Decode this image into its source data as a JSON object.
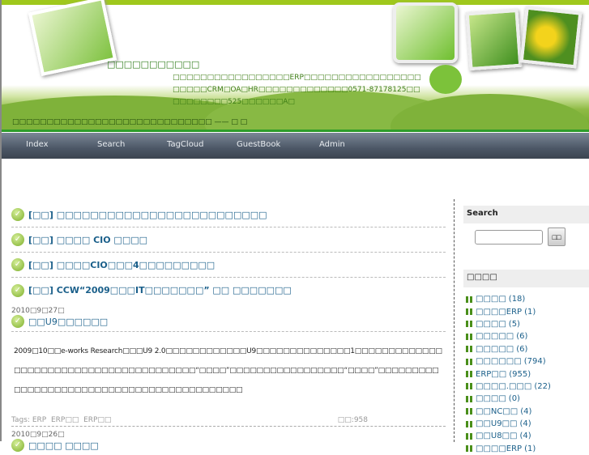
{
  "header": {
    "site_title": "□□□□□□□□□□□",
    "description": "□□□□□□□□□□□□□□□□□ERP□□□□□□□□□□□□□□□□□□□□□□CRM□OA□HR□□□□□□□□□□□□□0571-87178125□□□□□□□□□□525□□□□□□A□",
    "motto": "□□□□□□□□□□□□□□□□□□□□□□□□□□□□□ —— □ □"
  },
  "nav": [
    {
      "label": "Index"
    },
    {
      "label": "Search"
    },
    {
      "label": "TagCloud"
    },
    {
      "label": "GuestBook"
    },
    {
      "label": "Admin"
    }
  ],
  "sticky": [
    {
      "prefix": "[□□]",
      "title": "□□□□□□□□□□□□□□□□□□□□□□□□□"
    },
    {
      "prefix": "[□□]",
      "title": "□□□□ CIO □□□□"
    },
    {
      "prefix": "[□□]",
      "title": "□□□□CIO□□□4□□□□□□□□□"
    },
    {
      "prefix": "[□□]",
      "title": "CCW“2009□□□IT□□□□□□□” □□ □□□□□□□"
    }
  ],
  "posts": [
    {
      "date": "2010□9□27□",
      "title": "□□U9□□□□□□",
      "body": "2009□10□□e-works Research□□□U9 2.0□□□□□□□□□□□□U9□□□□□□□□□□□□□□1□□□□□□□□□□□□□□□□□□□□□□□□□□□□□□□□□□□□□□□□“□□□□”□□□□□□□□□□□□□□□□□“□□□□”□□□□□□□□□□□□□□□□□□□□□□□□□□□□□□□□□□□□□□□□□□□",
      "tags_label": "Tags:",
      "tags": [
        "ERP",
        "ERP□□",
        "ERP□□"
      ],
      "views": "□□:958"
    },
    {
      "date": "2010□9□26□",
      "title": "□□□□ □□□□"
    }
  ],
  "sidebar": {
    "search_heading": "Search",
    "search_value": "",
    "search_button": "□□",
    "categories_heading": "□□□□",
    "categories": [
      {
        "name": "□□□□",
        "count": "(18)"
      },
      {
        "name": "□□□□ERP",
        "count": "(1)"
      },
      {
        "name": "□□□□",
        "count": "(5)"
      },
      {
        "name": "□□□□□",
        "count": "(6)"
      },
      {
        "name": "□□□□□",
        "count": "(6)"
      },
      {
        "name": "□□□□□□",
        "count": "(794)"
      },
      {
        "name": "ERP□□",
        "count": "(955)"
      },
      {
        "name": "□□□□.□□□",
        "count": "(22)"
      },
      {
        "name": "□□□□",
        "count": "(0)"
      },
      {
        "name": "□□NC□□",
        "count": "(4)"
      },
      {
        "name": "□□U9□□",
        "count": "(4)"
      },
      {
        "name": "□□U8□□",
        "count": "(4)"
      },
      {
        "name": "□□□□ERP",
        "count": "(1)"
      }
    ]
  }
}
